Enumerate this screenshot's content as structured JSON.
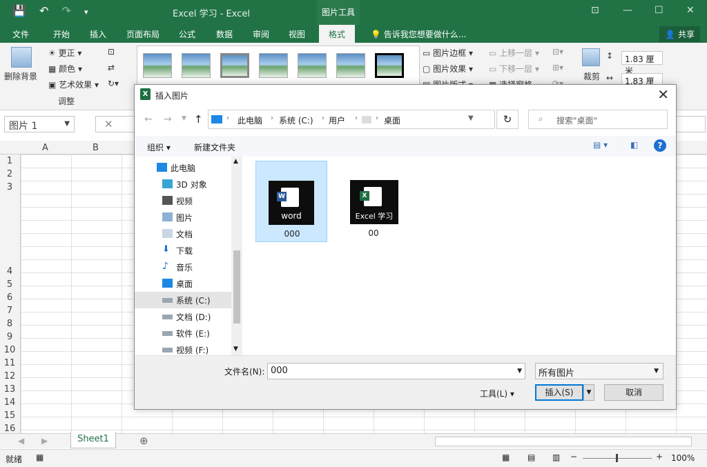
{
  "titlebar": {
    "title": "Excel 学习  -  Excel",
    "context_tab": "图片工具",
    "qat": {
      "save": "💾",
      "undo": "↶",
      "redo": "↷",
      "customize": "▾"
    },
    "window_controls": {
      "restore_ribbon": "⊡",
      "minimize": "—",
      "maximize": "☐",
      "close": "✕"
    }
  },
  "tabs": {
    "file": "文件",
    "home": "开始",
    "insert": "插入",
    "layout": "页面布局",
    "formulas": "公式",
    "data": "数据",
    "review": "审阅",
    "view": "视图",
    "format": "格式",
    "tell": "告诉我您想要做什么...",
    "share": "共享"
  },
  "ribbon": {
    "remove_bg": "删除背景",
    "corrections": "更正",
    "color": "颜色",
    "artistic": "艺术效果",
    "adjust_group": "调整",
    "border": "图片边框",
    "effects": "图片效果",
    "layout": "图片版式",
    "forward": "上移一层",
    "backward": "下移一层",
    "selection_pane": "选择窗格",
    "crop": "裁剪",
    "height": "1.83 厘米",
    "width": "1.83 厘米"
  },
  "namebox": "图片 1",
  "columns": [
    "A",
    "B"
  ],
  "rows": [
    "1",
    "2",
    "3",
    "4",
    "5",
    "6",
    "7",
    "8",
    "9",
    "10",
    "11",
    "12",
    "13",
    "14",
    "15",
    "16"
  ],
  "sheet_tab": "Sheet1",
  "status": {
    "ready": "就绪",
    "zoom": "100%"
  },
  "dialog": {
    "title": "插入图片",
    "breadcrumb": [
      "此电脑",
      "系统 (C:)",
      "用户",
      "桌面"
    ],
    "search_placeholder": "搜索\"桌面\"",
    "organize": "组织",
    "new_folder": "新建文件夹",
    "nav": [
      {
        "label": "此电脑",
        "icon": "pc-icon"
      },
      {
        "label": "3D 对象",
        "icon": "cube-icon"
      },
      {
        "label": "视频",
        "icon": "video-icon"
      },
      {
        "label": "图片",
        "icon": "picture-icon"
      },
      {
        "label": "文档",
        "icon": "document-icon"
      },
      {
        "label": "下载",
        "icon": "download-icon"
      },
      {
        "label": "音乐",
        "icon": "music-icon"
      },
      {
        "label": "桌面",
        "icon": "desktop-icon"
      },
      {
        "label": "系统 (C:)",
        "icon": "drive-icon"
      },
      {
        "label": "文档 (D:)",
        "icon": "drive-icon"
      },
      {
        "label": "软件 (E:)",
        "icon": "drive-icon"
      },
      {
        "label": "视频 (F:)",
        "icon": "drive-icon"
      }
    ],
    "files": [
      {
        "name": "000",
        "thumb_text": "word",
        "icon": "word-file-icon"
      },
      {
        "name": "00",
        "thumb_text": "Excel 学习",
        "icon": "excel-file-icon"
      }
    ],
    "filename_label": "文件名(N):",
    "filename_value": "000",
    "filetype": "所有图片",
    "tools": "工具(L)",
    "insert": "插入(S)",
    "cancel": "取消"
  },
  "colors": {
    "excel_green": "#217346",
    "select_blue": "#cce8ff",
    "focus_blue": "#0078d7"
  }
}
